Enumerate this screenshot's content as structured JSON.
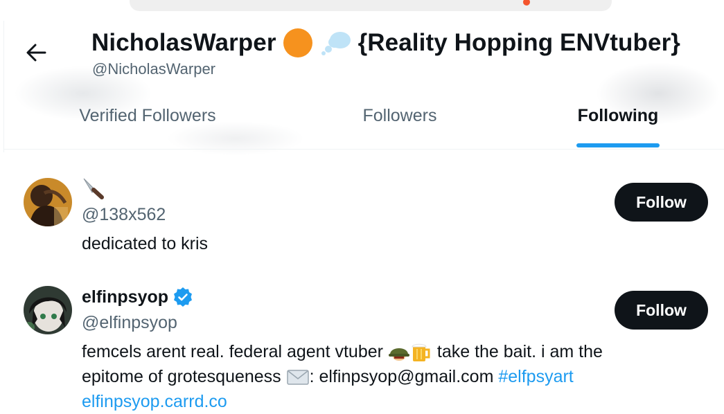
{
  "header": {
    "display_name": "NicholasWarper",
    "name_suffix": "{Reality Hopping ENVtuber}",
    "handle": "@NicholasWarper",
    "back_icon": "arrow-left-icon",
    "name_icons": [
      "orange-circle-icon",
      "thought-balloon-icon"
    ]
  },
  "tabs": [
    {
      "label": "Verified Followers",
      "active": false
    },
    {
      "label": "Followers",
      "active": false
    },
    {
      "label": "Following",
      "active": true
    }
  ],
  "users": [
    {
      "name_icon": "kitchen-knife-icon",
      "handle": "@138x562",
      "bio": "dedicated to kris",
      "follow_label": "Follow"
    },
    {
      "name": "elfinpsyop",
      "verified": true,
      "handle": "@elfinpsyop",
      "bio_part1": "femcels arent real. federal agent vtuber",
      "bio_part2": "take the bait. i am the",
      "bio_part3": "epitome of grotesqueness",
      "bio_part4": ": elfinpsyop@gmail.com",
      "hashtag": "#elfpsyart",
      "link": "elfinpsyop.carrd.co",
      "bio_icons": [
        "military-helmet-icon",
        "beer-mug-icon",
        "envelope-icon"
      ],
      "follow_label": "Follow"
    }
  ],
  "colors": {
    "accent": "#1d9bf0",
    "text": "#0f1419",
    "secondary": "#536471",
    "button": "#0f1419"
  }
}
